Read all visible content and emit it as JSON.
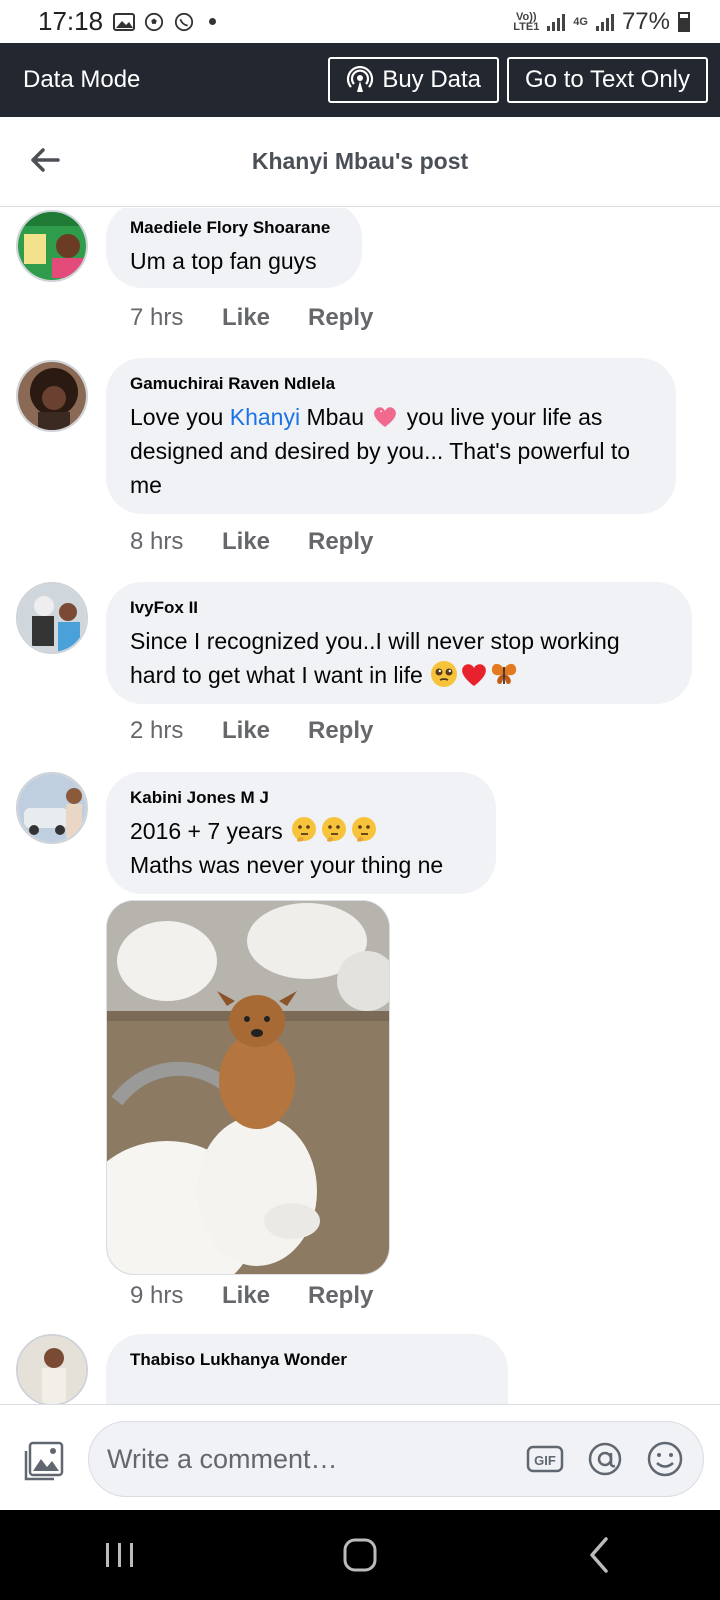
{
  "status_bar": {
    "time": "17:18",
    "network_1": "Vo)) LTE1",
    "network_2": "4G",
    "battery": "77%"
  },
  "data_mode_bar": {
    "title": "Data Mode",
    "buy_data": "Buy Data",
    "text_only": "Go to Text Only"
  },
  "header": {
    "title": "Khanyi Mbau's post"
  },
  "comments": [
    {
      "author": "Maediele Flory Shoarane",
      "text": "Um a top fan guys",
      "time": "7 hrs",
      "like": "Like",
      "reply": "Reply"
    },
    {
      "author": "Gamuchirai Raven Ndlela",
      "text_before": "Love you ",
      "mention": "Khanyi",
      "text_after_mention": " Mbau",
      "text_line_rest": " you live your life as designed and desired by you... That's powerful to me",
      "time": "8 hrs",
      "like": "Like",
      "reply": "Reply"
    },
    {
      "author": "IvyFox II",
      "text": "Since I recognized you..I will never stop working hard to get what I want in life",
      "time": "2 hrs",
      "like": "Like",
      "reply": "Reply"
    },
    {
      "author": "Kabini Jones M J",
      "line1": "2016 + 7 years",
      "line2": "Maths was never your thing ne",
      "time": "9 hrs",
      "like": "Like",
      "reply": "Reply"
    },
    {
      "author": "Thabiso Lukhanya Wonder"
    }
  ],
  "composer": {
    "placeholder": "Write a comment…",
    "gif_label": "GIF"
  },
  "colors": {
    "data_bar_bg": "#23272f",
    "bubble_bg": "#f0f2f5",
    "mention": "#1b74e4",
    "muted_text": "#65676b"
  }
}
